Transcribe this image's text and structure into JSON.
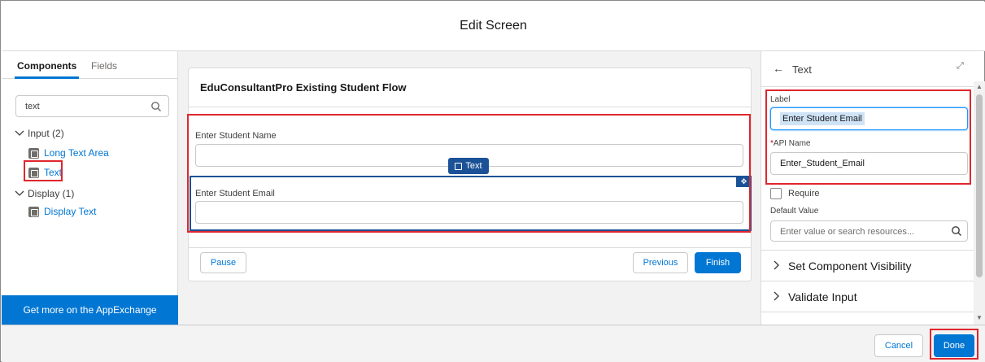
{
  "header": {
    "title": "Edit Screen"
  },
  "left_panel": {
    "tabs": [
      {
        "label": "Components"
      },
      {
        "label": "Fields"
      }
    ],
    "search": {
      "value": "text"
    },
    "groups": [
      {
        "label": "Input (2)",
        "items": [
          {
            "label": "Long Text Area"
          },
          {
            "label": "Text"
          }
        ]
      },
      {
        "label": "Display (1)",
        "items": [
          {
            "label": "Display Text"
          }
        ]
      }
    ],
    "appexchange_label": "Get more on the AppExchange"
  },
  "canvas": {
    "flow_title": "EduConsultantPro Existing Student Flow",
    "fields": [
      {
        "label": "Enter Student Name"
      },
      {
        "label": "Enter Student Email"
      }
    ],
    "selected_badge": "Text",
    "buttons": {
      "pause": "Pause",
      "previous": "Previous",
      "finish": "Finish"
    }
  },
  "right_panel": {
    "back_icon": "arrow-left-icon",
    "title": "Text",
    "label_field": {
      "label": "Label",
      "value": "Enter Student Email"
    },
    "api_name_field": {
      "required_mark": "*",
      "label": "API Name",
      "value": "Enter_Student_Email"
    },
    "require_label": "Require",
    "default_value": {
      "label": "Default Value",
      "placeholder": "Enter value or search resources..."
    },
    "sections": [
      {
        "label": "Set Component Visibility"
      },
      {
        "label": "Validate Input"
      }
    ]
  },
  "footer": {
    "cancel": "Cancel",
    "done": "Done"
  },
  "colors": {
    "brand": "#0176d3",
    "highlight": "#e0262d",
    "selection": "#1b5297"
  }
}
